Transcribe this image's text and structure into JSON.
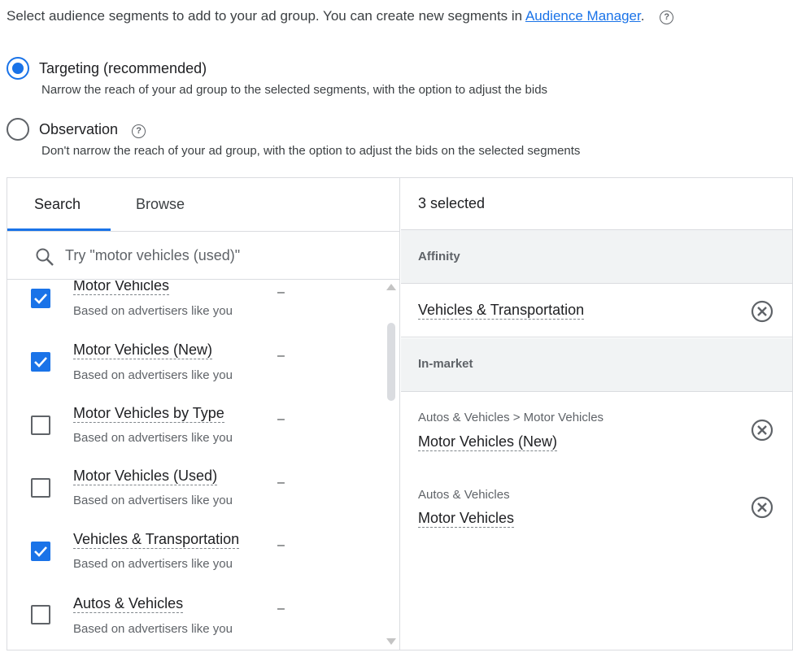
{
  "intro": {
    "text": "Select audience segments to add to your ad group. You can create new segments in",
    "link": "Audience Manager",
    "period": ".",
    "help": "?"
  },
  "modes": [
    {
      "label": "Targeting (recommended)",
      "description": "Narrow the reach of your ad group to the selected segments, with the option to adjust the bids",
      "selected": true
    },
    {
      "label": "Observation",
      "description": "Don't narrow the reach of your ad group, with the option to adjust the bids on the selected segments",
      "selected": false,
      "help": "?"
    }
  ],
  "tabs": [
    "Search",
    "Browse"
  ],
  "search": {
    "placeholder": "Try \"motor vehicles (used)\""
  },
  "items": [
    {
      "title": "Motor Vehicles",
      "sub": "Based on advertisers like you",
      "metric": "–",
      "checked": true
    },
    {
      "title": "Motor Vehicles (New)",
      "sub": "Based on advertisers like you",
      "metric": "–",
      "checked": true
    },
    {
      "title": "Motor Vehicles by Type",
      "sub": "Based on advertisers like you",
      "metric": "–",
      "checked": false
    },
    {
      "title": "Motor Vehicles (Used)",
      "sub": "Based on advertisers like you",
      "metric": "–",
      "checked": false
    },
    {
      "title": "Vehicles & Transportation",
      "sub": "Based on advertisers like you",
      "metric": "–",
      "checked": true
    },
    {
      "title": "Autos & Vehicles",
      "sub": "Based on advertisers like you",
      "metric": "–",
      "checked": false
    }
  ],
  "selected": {
    "count_label": "3 selected",
    "categories": [
      "Affinity",
      "In-market"
    ],
    "items": [
      {
        "path": "",
        "name": "Vehicles & Transportation"
      },
      {
        "path": "Autos & Vehicles > Motor Vehicles",
        "name": "Motor Vehicles (New)"
      },
      {
        "path": "Autos & Vehicles",
        "name": "Motor Vehicles"
      }
    ]
  },
  "colors": {
    "accent": "#1a73e8",
    "border": "#dadce0",
    "category_bg": "#f1f3f4"
  }
}
